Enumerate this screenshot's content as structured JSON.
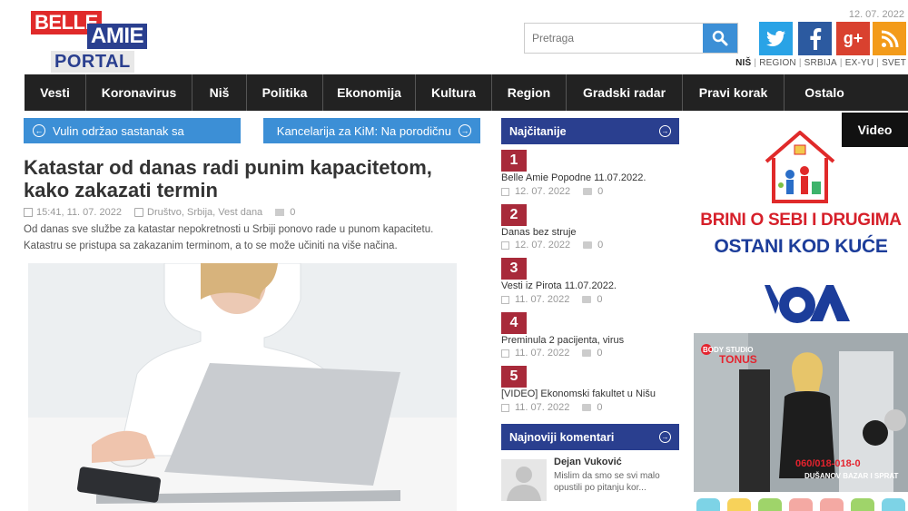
{
  "header": {
    "logo": {
      "line1": "BELLE",
      "line2": "AMIE",
      "line3": "PORTAL"
    },
    "date": "12. 07. 2022",
    "search_placeholder": "Pretraga",
    "regions": [
      "NIŠ",
      "REGION",
      "SRBIJA",
      "EX-YU",
      "SVET"
    ]
  },
  "social": {
    "twitter_icon": "twitter-icon",
    "facebook_icon": "facebook-icon",
    "gplus_label": "g+",
    "rss_icon": "rss-icon"
  },
  "nav": [
    "Vesti",
    "Koronavirus",
    "Niš",
    "Politika",
    "Ekonomija",
    "Kultura",
    "Region",
    "Gradski radar",
    "Pravi korak",
    "Ostalo"
  ],
  "article": {
    "prev_label": "Vulin održao sastanak sa",
    "next_label": "Kancelarija za KiM: Na porodičnu",
    "title": "Katastar od danas radi punim kapacitetom, kako zakazati termin",
    "time": "15:41, 11. 07. 2022",
    "categories": "Društvo, Srbija, Vest dana",
    "comments": "0",
    "lead": "Od danas sve službe za katastar nepokretnosti u Srbiji ponovo rade u punom kapacitetu. Katastru se pristupa sa zakazanim terminom, a to se može učiniti na više načina."
  },
  "most_read": {
    "heading": "Najčitanije",
    "items": [
      {
        "rank": "1",
        "title": "Belle Amie Popodne 11.07.2022.",
        "date": "12. 07. 2022",
        "comments": "0"
      },
      {
        "rank": "2",
        "title": "Danas bez struje",
        "date": "12. 07. 2022",
        "comments": "0"
      },
      {
        "rank": "3",
        "title": "Vesti iz Pirota 11.07.2022.",
        "date": "11. 07. 2022",
        "comments": "0"
      },
      {
        "rank": "4",
        "title": "Preminula 2 pacijenta, virus",
        "date": "11. 07. 2022",
        "comments": "0"
      },
      {
        "rank": "5",
        "title": "[VIDEO] Ekonomski fakultet u Nišu",
        "date": "11. 07. 2022",
        "comments": "0"
      }
    ]
  },
  "latest_comments": {
    "heading": "Najnoviji komentari",
    "author": "Dejan Vuković",
    "text": "Mislim da smo se svi malo opustili po pitanju kor..."
  },
  "right": {
    "video_label": "Video",
    "ad1_line1": "BRINI O SEBI I DRUGIMA",
    "ad1_line2": "OSTANI KOD KUĆE",
    "voa": "VOA",
    "ad2_brand1": "BODY STUDIO",
    "ad2_brand2": "TONUS",
    "ad2_phone": "060/018-018-0",
    "ad2_addr": "DUŠANOV BAZAR I SPRAT"
  },
  "colors": {
    "accent_blue": "#3c8fd6",
    "navy": "#2a3f8f",
    "rank_red": "#a82a3a",
    "nav_bg": "#222222"
  }
}
